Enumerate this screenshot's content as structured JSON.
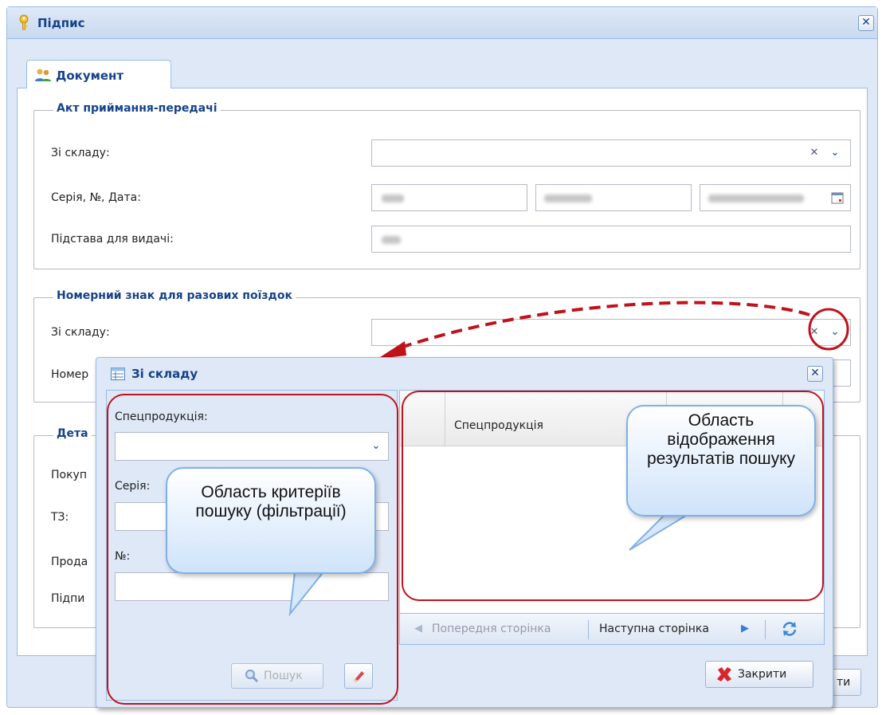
{
  "outer_window": {
    "title": "Підпис",
    "tab_label": "Документ",
    "section_act": {
      "legend": "Акт приймання-передачі",
      "from_warehouse_label": "Зі складу:",
      "series_label": "Серія, №, Дата:",
      "basis_label": "Підстава для видачі:"
    },
    "section_plate": {
      "legend": "Номерний знак для разових поїздок",
      "from_warehouse_label": "Зі складу:",
      "number_label_partial": "Номер"
    },
    "section_details": {
      "legend_partial": "Дета",
      "buyer_partial": "Покуп",
      "tz_label": "ТЗ:",
      "seller_partial": "Прода",
      "signature_partial": "Підпи"
    },
    "footer_button_partial": "ти"
  },
  "inner_window": {
    "title": "Зі складу",
    "filters": {
      "product_label": "Спецпродукція:",
      "series_label": "Серія:",
      "number_label": "№:",
      "search_button": "Пошук"
    },
    "grid": {
      "column_header": "Спецпродукція"
    },
    "pager": {
      "prev_label": "Попередня сторінка",
      "next_label": "Наступна сторінка"
    },
    "close_button": "Закрити"
  },
  "callouts": {
    "filter_area": "Область критеріїв пошуку (фільтрації)",
    "results_area": "Область відображення результатів пошуку"
  },
  "colors": {
    "title_blue": "#15428b",
    "annotation_red": "#c0121b",
    "panel_bg": "#dfe8f6"
  }
}
